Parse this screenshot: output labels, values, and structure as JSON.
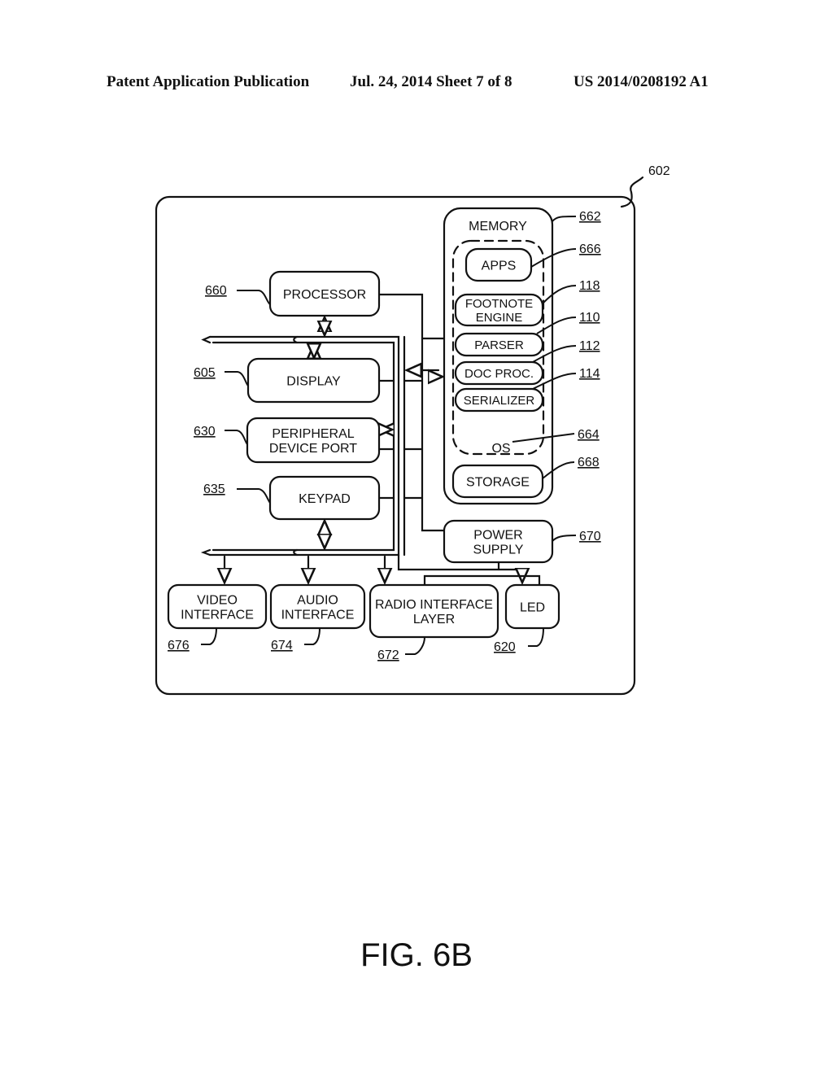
{
  "header": {
    "left": "Patent Application Publication",
    "date_sheet": "Jul. 24, 2014   Sheet 7 of 8",
    "pub_number": "US 2014/0208192 A1"
  },
  "figure": {
    "caption": "FIG. 6B",
    "device_ref": "602",
    "blocks": {
      "processor": {
        "label": [
          "PROCESSOR"
        ],
        "ref": "660"
      },
      "display": {
        "label": [
          "DISPLAY"
        ],
        "ref": "605"
      },
      "peripheral": {
        "label": [
          "PERIPHERAL",
          "DEVICE PORT"
        ],
        "ref": "630"
      },
      "keypad": {
        "label": [
          "KEYPAD"
        ],
        "ref": "635"
      },
      "memory": {
        "label": [
          "MEMORY"
        ],
        "ref": "662"
      },
      "apps": {
        "label": [
          "APPS"
        ],
        "ref": "666"
      },
      "footnote": {
        "label": [
          "FOOTNOTE",
          "ENGINE"
        ],
        "ref": "118"
      },
      "parser": {
        "label": [
          "PARSER"
        ],
        "ref": "110"
      },
      "docproc": {
        "label": [
          "DOC PROC."
        ],
        "ref": "112"
      },
      "serializer": {
        "label": [
          "SERIALIZER"
        ],
        "ref": "114"
      },
      "os": {
        "label": [
          "OS"
        ],
        "ref": "664"
      },
      "storage": {
        "label": [
          "STORAGE"
        ],
        "ref": "668"
      },
      "power": {
        "label": [
          "POWER",
          "SUPPLY"
        ],
        "ref": "670"
      },
      "video": {
        "label": [
          "VIDEO",
          "INTERFACE"
        ],
        "ref": "676"
      },
      "audio": {
        "label": [
          "AUDIO",
          "INTERFACE"
        ],
        "ref": "674"
      },
      "radio": {
        "label": [
          "RADIO INTERFACE",
          "LAYER"
        ],
        "ref": "672"
      },
      "led": {
        "label": [
          "LED"
        ],
        "ref": "620"
      }
    }
  }
}
